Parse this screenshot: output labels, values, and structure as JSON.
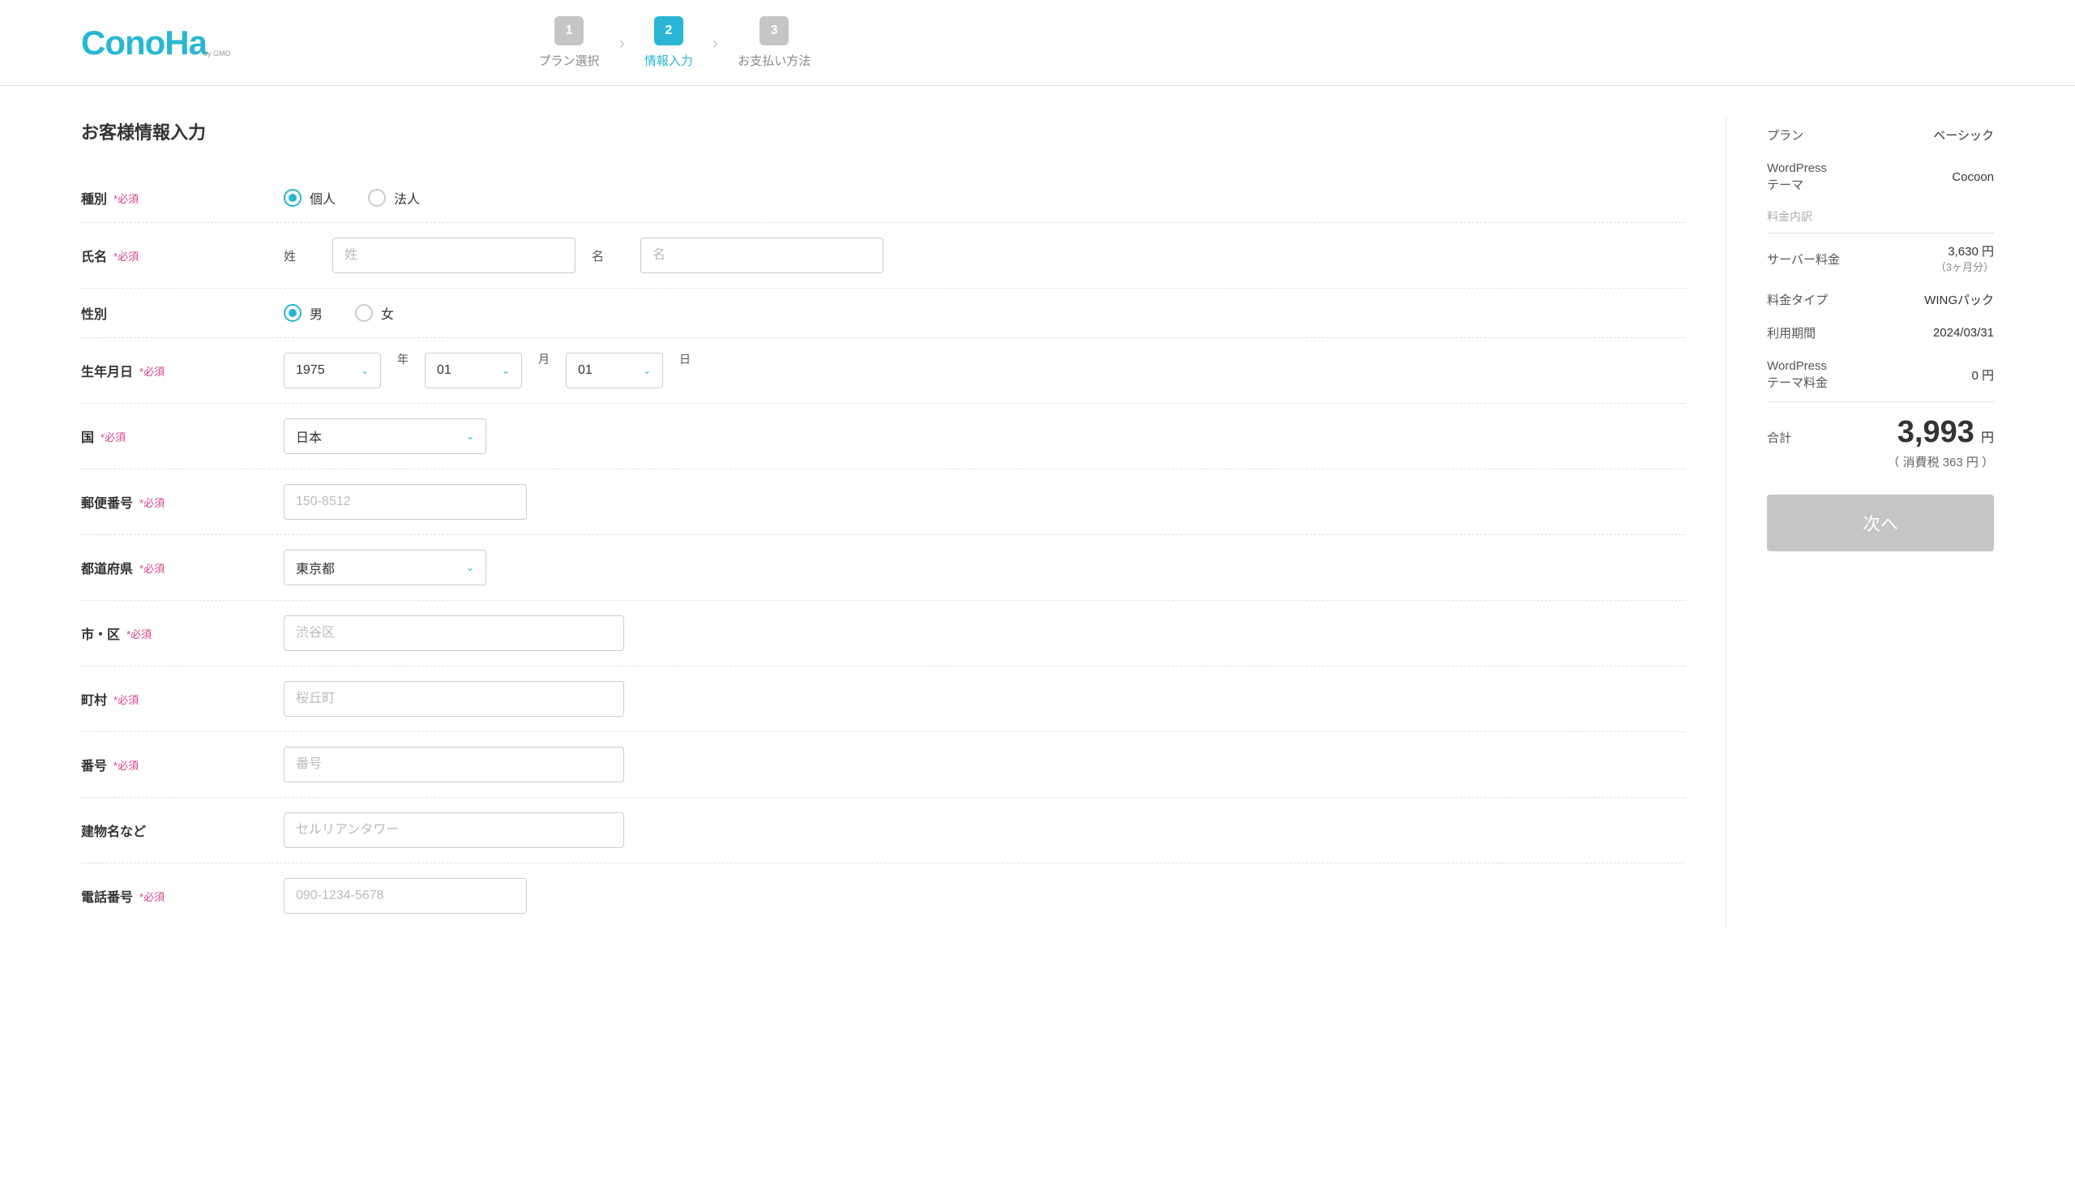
{
  "logo": {
    "main": "ConoHa",
    "sub": "by GMO"
  },
  "stepper": {
    "step1": {
      "num": "1",
      "label": "プラン選択"
    },
    "step2": {
      "num": "2",
      "label": "情報入力"
    },
    "step3": {
      "num": "3",
      "label": "お支払い方法"
    }
  },
  "title": "お客様情報入力",
  "required_mark": "*必須",
  "fields": {
    "type": {
      "label": "種別",
      "options": {
        "individual": "個人",
        "corporate": "法人"
      }
    },
    "name": {
      "label": "氏名",
      "last_sub": "姓",
      "first_sub": "名",
      "last_ph": "姓",
      "first_ph": "名"
    },
    "gender": {
      "label": "性別",
      "options": {
        "male": "男",
        "female": "女"
      }
    },
    "birth": {
      "label": "生年月日",
      "year": "1975",
      "month": "01",
      "day": "01",
      "year_suf": "年",
      "month_suf": "月",
      "day_suf": "日"
    },
    "country": {
      "label": "国",
      "value": "日本"
    },
    "postal": {
      "label": "郵便番号",
      "ph": "150-8512"
    },
    "prefecture": {
      "label": "都道府県",
      "value": "東京都"
    },
    "city": {
      "label": "市・区",
      "ph": "渋谷区"
    },
    "town": {
      "label": "町村",
      "ph": "桜丘町"
    },
    "street": {
      "label": "番号",
      "ph": "番号"
    },
    "building": {
      "label": "建物名など",
      "ph": "セルリアンタワー"
    },
    "phone": {
      "label": "電話番号",
      "ph": "090-1234-5678"
    }
  },
  "summary": {
    "plan_label": "プラン",
    "plan_value": "ベーシック",
    "theme_label1": "WordPress",
    "theme_label2": "テーマ",
    "theme_value": "Cocoon",
    "breakdown": "料金内訳",
    "server_label": "サーバー料金",
    "server_value": "3,630 円",
    "server_sub": "（3ヶ月分）",
    "price_type_label": "料金タイプ",
    "price_type_value": "WINGパック",
    "period_label": "利用期間",
    "period_value": "2024/03/31",
    "theme_fee_label1": "WordPress",
    "theme_fee_label2": "テーマ料金",
    "theme_fee_value": "0 円",
    "total_label": "合計",
    "total_value": "3,993",
    "total_unit": "円",
    "tax": "（ 消費税 363 円 ）",
    "next": "次へ"
  }
}
